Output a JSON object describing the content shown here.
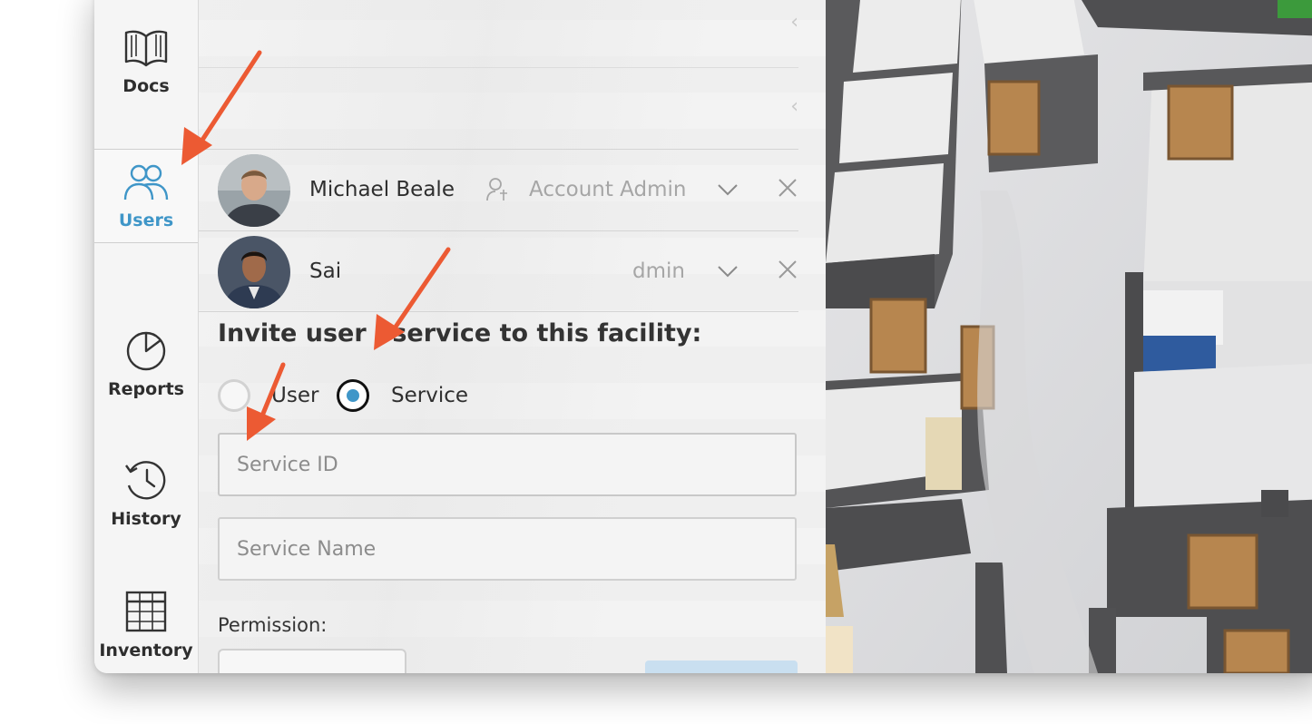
{
  "nav": {
    "items": [
      {
        "label": "Docs",
        "icon": "book-icon"
      },
      {
        "label": "Users",
        "icon": "users-icon",
        "active": true
      },
      {
        "label": "Reports",
        "icon": "pie-chart-icon"
      },
      {
        "label": "History",
        "icon": "history-icon"
      },
      {
        "label": "Inventory",
        "icon": "table-grid-icon"
      }
    ]
  },
  "users": [
    {
      "name": "Michael Beale",
      "role": "Account Admin"
    },
    {
      "name": "Sai",
      "role": "Account Admin",
      "role_visible": "dmin"
    }
  ],
  "invite": {
    "title": "Invite user / service to this facility:",
    "options": [
      {
        "label": "User",
        "selected": false
      },
      {
        "label": "Service",
        "selected": true
      }
    ],
    "service_id_placeholder": "Service ID",
    "service_name_placeholder": "Service Name",
    "permission_label": "Permission:"
  },
  "colors": {
    "accent": "#3f96c8",
    "annotation": "#ec5a33"
  }
}
